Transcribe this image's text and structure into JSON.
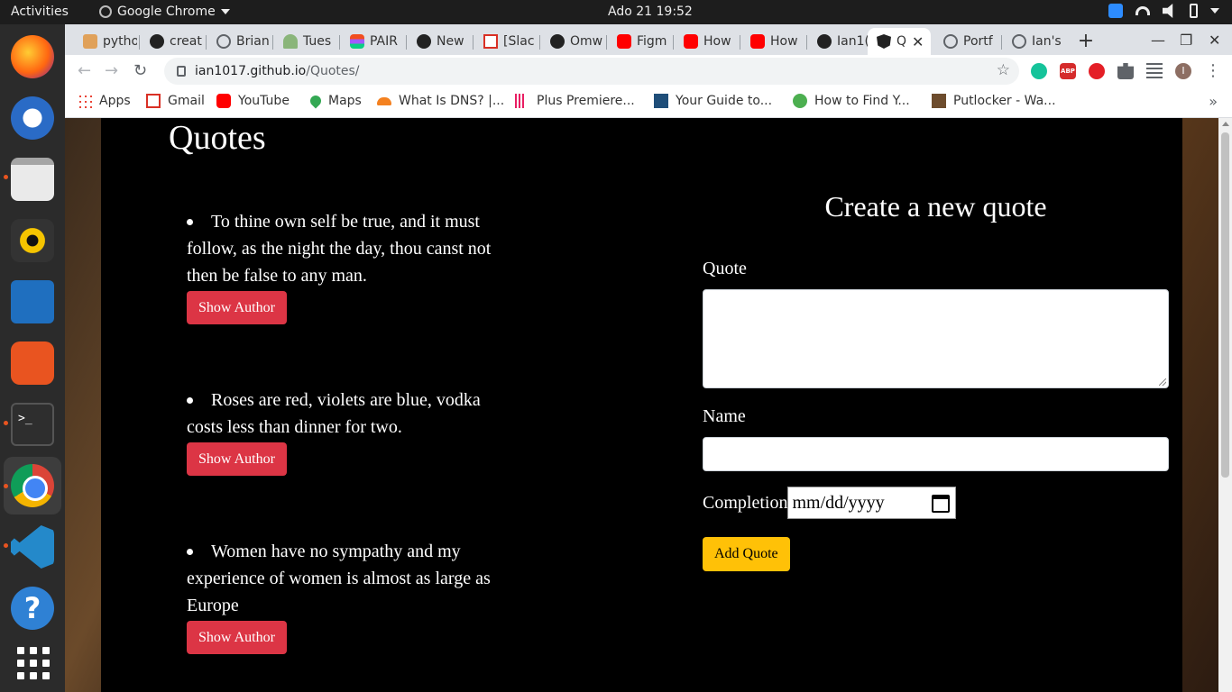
{
  "system": {
    "activities": "Activities",
    "app_name": "Google Chrome",
    "clock": "Ado 21  19:52"
  },
  "dock": {
    "items": [
      "firefox",
      "thunderbird",
      "files",
      "rhythmbox",
      "libreoffice-writer",
      "software-center",
      "terminal",
      "chrome",
      "vscode",
      "help",
      "show-applications"
    ]
  },
  "browser": {
    "tabs": [
      {
        "label": "pytho",
        "icon": "python-icon"
      },
      {
        "label": "creat",
        "icon": "github-icon"
      },
      {
        "label": "Brian",
        "icon": "globe-icon"
      },
      {
        "label": "Tues",
        "icon": "tree-icon"
      },
      {
        "label": "PAIR",
        "icon": "figma-icon"
      },
      {
        "label": "New",
        "icon": "github-icon"
      },
      {
        "label": "[Slac",
        "icon": "gmail-icon"
      },
      {
        "label": "Omw",
        "icon": "github-icon"
      },
      {
        "label": "Figm",
        "icon": "youtube-icon"
      },
      {
        "label": "How",
        "icon": "youtube-icon"
      },
      {
        "label": "How",
        "icon": "youtube-icon"
      },
      {
        "label": "Ian1(",
        "icon": "github-icon"
      },
      {
        "label": "Q",
        "icon": "angular-icon",
        "active": true
      },
      {
        "label": "Portf",
        "icon": "globe-icon"
      },
      {
        "label": "Ian's",
        "icon": "globe-icon"
      }
    ],
    "new_tab": "+",
    "url_host": "ian1017.github.io",
    "url_path": "/Quotes/",
    "bookmarks": [
      {
        "label": "Apps"
      },
      {
        "label": "Gmail"
      },
      {
        "label": "YouTube"
      },
      {
        "label": "Maps"
      },
      {
        "label": "What Is DNS? |..."
      },
      {
        "label": "Plus Premiere..."
      },
      {
        "label": "Your Guide to..."
      },
      {
        "label": "How to Find Y..."
      },
      {
        "label": "Putlocker - Wa..."
      }
    ],
    "bookmarks_more": "»",
    "avatar_initial": "I",
    "abp": "ABP"
  },
  "page": {
    "title": "Quotes",
    "quotes": [
      {
        "text": "To thine own self be true, and it must follow, as the night the day, thou canst not then be false to any man.",
        "button": "Show Author"
      },
      {
        "text": "Roses are red, violets are blue, vodka costs less than dinner for two.",
        "button": "Show Author"
      },
      {
        "text": "Women have no sympathy and my experience of women is almost as large as Europe",
        "button": "Show Author"
      }
    ],
    "form": {
      "title": "Create a new quote",
      "quote_label": "Quote",
      "name_label": "Name",
      "completion_label": "Completion",
      "date_placeholder": "mm/dd/yyyy",
      "submit": "Add Quote"
    }
  },
  "colors": {
    "danger": "#dc3545",
    "warning": "#ffc107"
  }
}
